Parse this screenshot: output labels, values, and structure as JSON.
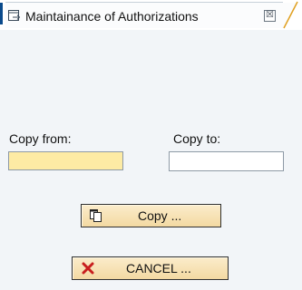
{
  "window": {
    "tab_title": "Maintainance of Authorizations",
    "close_symbol": "☒"
  },
  "form": {
    "copy_from_label": "Copy from:",
    "copy_to_label": "Copy to:",
    "copy_from_value": "",
    "copy_to_value": "",
    "required_field_color": "#fdeba4"
  },
  "buttons": {
    "copy_label": "Copy ...",
    "copy_icon": "copy-icon",
    "cancel_label": "CANCEL ...",
    "cancel_icon": "cancel-x-icon",
    "cancel_icon_color": "#c81e1e"
  }
}
